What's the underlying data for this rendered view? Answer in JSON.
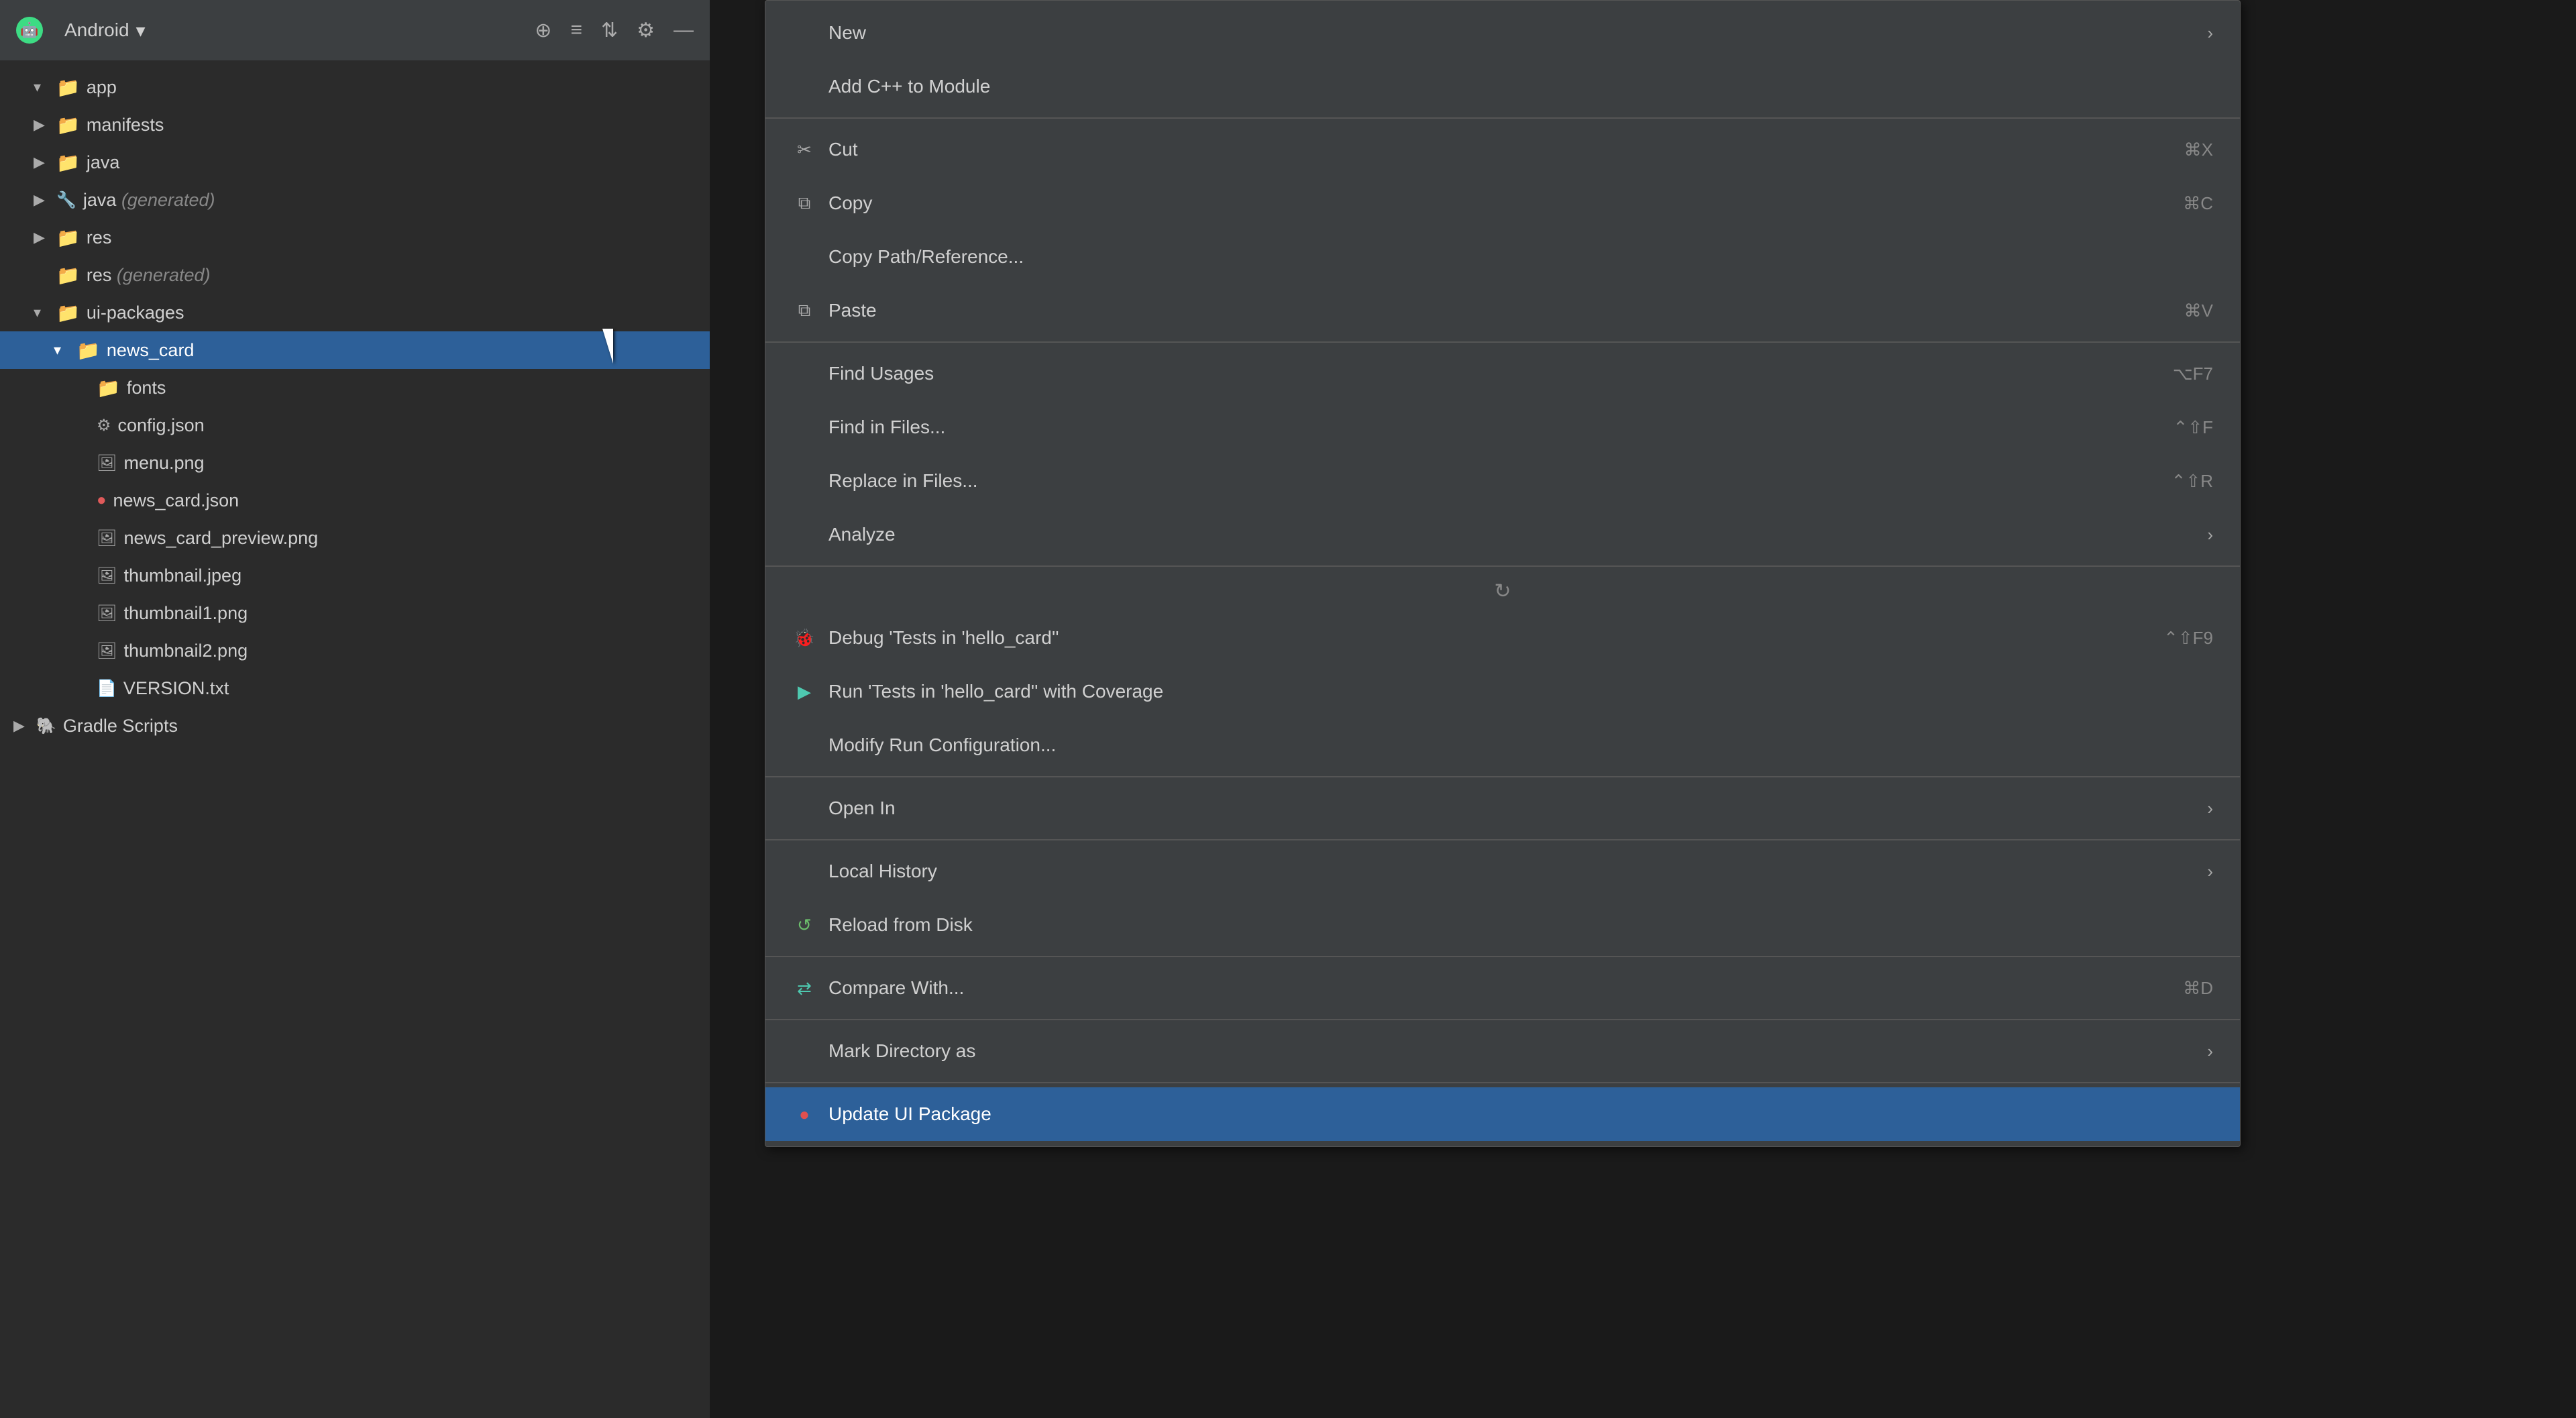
{
  "toolbar": {
    "title": "Android",
    "dropdown_arrow": "▾",
    "icons": [
      "⊕",
      "☰",
      "⇕",
      "⚙",
      "—"
    ]
  },
  "tree": {
    "items": [
      {
        "id": "app",
        "label": "app",
        "indent": 0,
        "arrow": "▾",
        "icon": "folder",
        "color": "blue",
        "selected": false
      },
      {
        "id": "manifests",
        "label": "manifests",
        "indent": 1,
        "arrow": "▶",
        "icon": "folder",
        "color": "blue",
        "selected": false
      },
      {
        "id": "java",
        "label": "java",
        "indent": 1,
        "arrow": "▶",
        "icon": "folder",
        "color": "blue",
        "selected": false
      },
      {
        "id": "java-generated",
        "label": "java",
        "suffix": " (generated)",
        "indent": 1,
        "arrow": "▶",
        "icon": "folder-special",
        "color": "blue",
        "selected": false
      },
      {
        "id": "res",
        "label": "res",
        "indent": 1,
        "arrow": "▶",
        "icon": "folder",
        "color": "blue",
        "selected": false
      },
      {
        "id": "res-generated",
        "label": "res",
        "suffix": " (generated)",
        "indent": 1,
        "arrow": "",
        "icon": "folder",
        "color": "blue",
        "selected": false
      },
      {
        "id": "ui-packages",
        "label": "ui-packages",
        "indent": 1,
        "arrow": "▾",
        "icon": "folder",
        "color": "blue",
        "selected": false
      },
      {
        "id": "news_card",
        "label": "news_card",
        "indent": 2,
        "arrow": "▾",
        "icon": "folder",
        "color": "blue",
        "selected": true
      },
      {
        "id": "fonts",
        "label": "fonts",
        "indent": 3,
        "arrow": "",
        "icon": "folder",
        "color": "blue",
        "selected": false
      },
      {
        "id": "config.json",
        "label": "config.json",
        "indent": 3,
        "arrow": "",
        "icon": "file-json",
        "color": "normal",
        "selected": false
      },
      {
        "id": "menu.png",
        "label": "menu.png",
        "indent": 3,
        "arrow": "",
        "icon": "file-img",
        "color": "normal",
        "selected": false
      },
      {
        "id": "news_card.json",
        "label": "news_card.json",
        "indent": 3,
        "arrow": "",
        "icon": "file-special",
        "color": "red",
        "selected": false
      },
      {
        "id": "news_card_preview.png",
        "label": "news_card_preview.png",
        "indent": 3,
        "arrow": "",
        "icon": "file-img",
        "color": "normal",
        "selected": false
      },
      {
        "id": "thumbnail.jpeg",
        "label": "thumbnail.jpeg",
        "indent": 3,
        "arrow": "",
        "icon": "file-img",
        "color": "normal",
        "selected": false
      },
      {
        "id": "thumbnail1.png",
        "label": "thumbnail1.png",
        "indent": 3,
        "arrow": "",
        "icon": "file-img",
        "color": "normal",
        "selected": false
      },
      {
        "id": "thumbnail2.png",
        "label": "thumbnail2.png",
        "indent": 3,
        "arrow": "",
        "icon": "file-img",
        "color": "normal",
        "selected": false
      },
      {
        "id": "VERSION.txt",
        "label": "VERSION.txt",
        "indent": 3,
        "arrow": "",
        "icon": "file-txt",
        "color": "normal",
        "selected": false
      },
      {
        "id": "gradle",
        "label": "Gradle Scripts",
        "indent": 0,
        "arrow": "▶",
        "icon": "gradle",
        "color": "normal",
        "selected": false
      }
    ]
  },
  "context_menu": {
    "items": [
      {
        "id": "new",
        "label": "New",
        "icon": "",
        "shortcut": "",
        "has_submenu": true,
        "separator_after": false,
        "highlighted": false
      },
      {
        "id": "add-cpp",
        "label": "Add C++ to Module",
        "icon": "",
        "shortcut": "",
        "has_submenu": false,
        "separator_after": true,
        "highlighted": false
      },
      {
        "id": "cut",
        "label": "Cut",
        "icon": "✂",
        "shortcut": "⌘X",
        "has_submenu": false,
        "separator_after": false,
        "highlighted": false
      },
      {
        "id": "copy",
        "label": "Copy",
        "icon": "⧉",
        "shortcut": "⌘C",
        "has_submenu": false,
        "separator_after": false,
        "highlighted": false
      },
      {
        "id": "copy-path",
        "label": "Copy Path/Reference...",
        "icon": "",
        "shortcut": "",
        "has_submenu": false,
        "separator_after": false,
        "highlighted": false
      },
      {
        "id": "paste",
        "label": "Paste",
        "icon": "⧉",
        "shortcut": "⌘V",
        "has_submenu": false,
        "separator_after": true,
        "highlighted": false
      },
      {
        "id": "find-usages",
        "label": "Find Usages",
        "icon": "",
        "shortcut": "⌥F7",
        "has_submenu": false,
        "separator_after": false,
        "highlighted": false
      },
      {
        "id": "find-in-files",
        "label": "Find in Files...",
        "icon": "",
        "shortcut": "⌃⇧F",
        "has_submenu": false,
        "separator_after": false,
        "highlighted": false
      },
      {
        "id": "replace-in-files",
        "label": "Replace in Files...",
        "icon": "",
        "shortcut": "⌃⇧R",
        "has_submenu": false,
        "separator_after": false,
        "highlighted": false
      },
      {
        "id": "analyze",
        "label": "Analyze",
        "icon": "",
        "shortcut": "",
        "has_submenu": true,
        "separator_after": true,
        "highlighted": false
      },
      {
        "id": "spinner",
        "label": "",
        "icon": "spinner",
        "shortcut": "",
        "has_submenu": false,
        "separator_after": false,
        "highlighted": false,
        "is_spinner": true
      },
      {
        "id": "debug",
        "label": "Debug 'Tests in 'hello_card''",
        "icon": "🐞",
        "shortcut": "⌃⇧F9",
        "has_submenu": false,
        "separator_after": false,
        "highlighted": false,
        "icon_type": "debug"
      },
      {
        "id": "run-coverage",
        "label": "Run 'Tests in 'hello_card'' with Coverage",
        "icon": "▶",
        "shortcut": "",
        "has_submenu": false,
        "separator_after": false,
        "highlighted": false,
        "icon_type": "coverage"
      },
      {
        "id": "modify-run",
        "label": "Modify Run Configuration...",
        "icon": "",
        "shortcut": "",
        "has_submenu": false,
        "separator_after": true,
        "highlighted": false
      },
      {
        "id": "open-in",
        "label": "Open In",
        "icon": "",
        "shortcut": "",
        "has_submenu": true,
        "separator_after": true,
        "highlighted": false
      },
      {
        "id": "local-history",
        "label": "Local History",
        "icon": "",
        "shortcut": "",
        "has_submenu": true,
        "separator_after": false,
        "highlighted": false
      },
      {
        "id": "reload-disk",
        "label": "Reload from Disk",
        "icon": "↺",
        "shortcut": "",
        "has_submenu": false,
        "separator_after": true,
        "highlighted": false,
        "icon_type": "reload"
      },
      {
        "id": "compare-with",
        "label": "Compare With...",
        "icon": "⇄",
        "shortcut": "⌘D",
        "has_submenu": false,
        "separator_after": true,
        "highlighted": false,
        "icon_type": "compare"
      },
      {
        "id": "mark-dir",
        "label": "Mark Directory as",
        "icon": "",
        "shortcut": "",
        "has_submenu": true,
        "separator_after": true,
        "highlighted": false
      },
      {
        "id": "update-ui",
        "label": "Update UI Package",
        "icon": "●",
        "shortcut": "",
        "has_submenu": false,
        "separator_after": false,
        "highlighted": true,
        "icon_type": "update"
      }
    ]
  }
}
